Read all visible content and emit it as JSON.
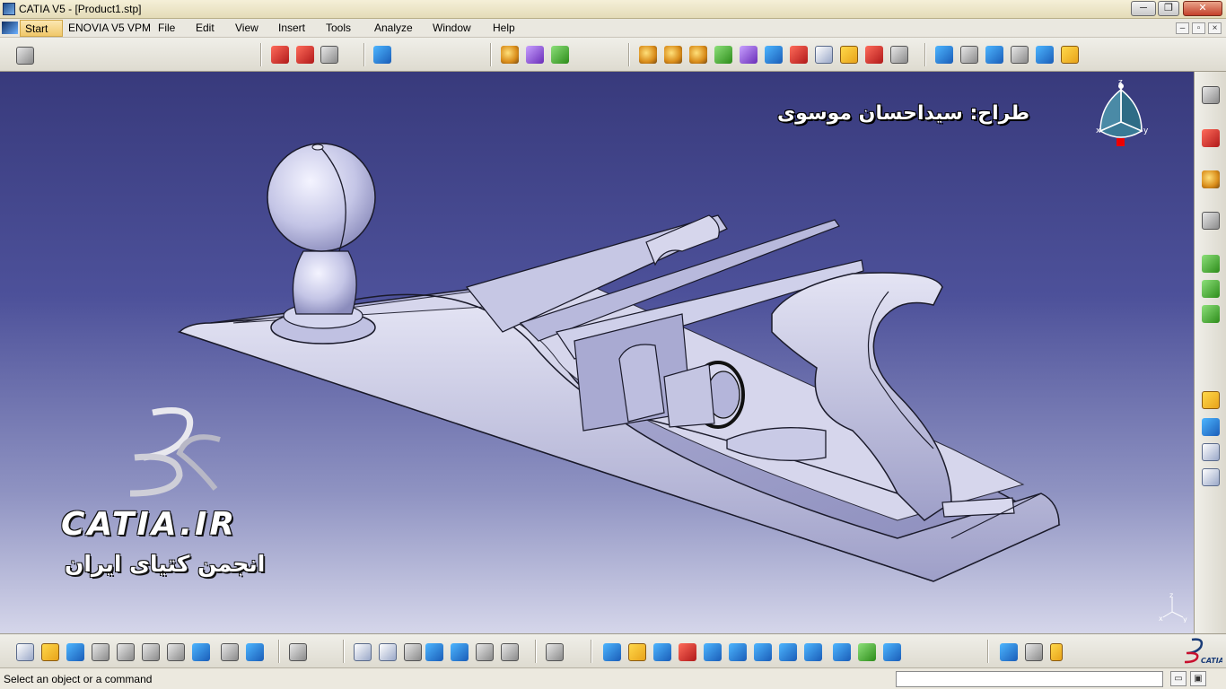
{
  "window": {
    "title": "CATIA V5 - [Product1.stp]",
    "minimize_glyph": "─",
    "restore_glyph": "❐",
    "close_glyph": "✕"
  },
  "menu": {
    "items": [
      "Start",
      "ENOVIA V5 VPM",
      "File",
      "Edit",
      "View",
      "Insert",
      "Tools",
      "Analyze",
      "Window",
      "Help"
    ],
    "doc_controls": [
      "–",
      "▫",
      "×"
    ]
  },
  "viewport": {
    "designer_credit": "طراح: سیداحسان موسوی",
    "brand_name": "CATIA.IR",
    "brand_subtitle": "انجمن کتیای ایران",
    "compass_labels": {
      "z": "z",
      "x": "x",
      "y": "y"
    },
    "background_top_color": "#383a7c",
    "background_bottom_color": "#d5d6ea",
    "model_color": "#c9cae6"
  },
  "toolbars": {
    "top_icons": [
      "product-management-icon",
      "assembly-constraints-icon",
      "part-design-icon",
      "structure-icon",
      "catalog-icon",
      "color-icon",
      "material-icon",
      "analysis-icon",
      "measure-icon",
      "section-icon",
      "clash-icon",
      "distance-icon",
      "annotation-icon",
      "bom-icon",
      "explode-icon",
      "move-icon",
      "snap-icon",
      "manipulate-icon",
      "fix-icon",
      "coincidence-icon",
      "contact-icon",
      "offset-icon",
      "angle-icon",
      "update-icon"
    ],
    "right_icons": [
      "settings-icon",
      "pcs-icon",
      "select-arrow-icon",
      "quick-select-icon",
      "new-component-icon",
      "new-product-icon",
      "new-part-icon",
      "existing-component-icon",
      "replace-component-icon",
      "graph-tree-icon",
      "generate-numbering-icon"
    ],
    "bottom_icons": [
      "new-icon",
      "open-icon",
      "save-icon",
      "print-icon",
      "cut-icon",
      "copy-icon",
      "paste-icon",
      "undo-icon",
      "redo-icon",
      "whats-this-icon",
      "capture-icon",
      "formula-icon",
      "knowledge-icon",
      "measure-item-icon",
      "table-icon",
      "tree-expand-icon",
      "lock-icon",
      "visualization-icon",
      "scenes-icon",
      "fly-mode-icon",
      "fit-all-icon",
      "pan-icon",
      "rotate-icon",
      "zoom-in-icon",
      "zoom-out-icon",
      "normal-view-icon",
      "multi-view-icon",
      "iso-view-icon",
      "render-style-icon",
      "hide-show-icon",
      "swap-visible-icon",
      "compass-icon",
      "catalog-browser-icon",
      "battery-icon"
    ]
  },
  "status": {
    "message": "Select an object or a command",
    "command_value": "",
    "btn1": "▭",
    "btn2": "▣"
  }
}
